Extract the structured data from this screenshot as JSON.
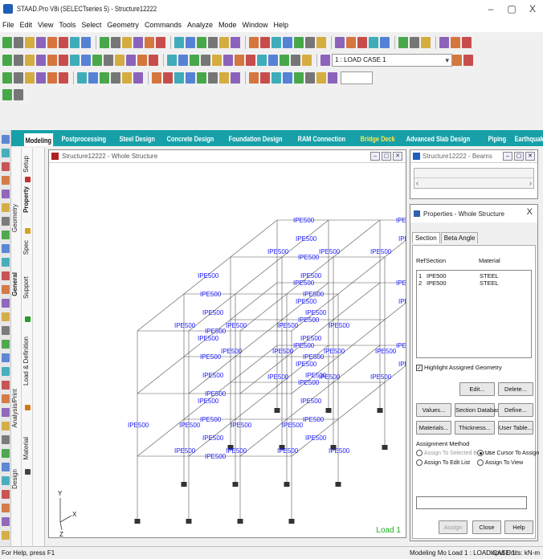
{
  "window": {
    "title": "STAAD.Pro V8i (SELECTseries 5) - Structure12222",
    "minimize": "–",
    "maximize": "▢",
    "close": "X"
  },
  "menu": [
    "File",
    "Edit",
    "View",
    "Tools",
    "Select",
    "Geometry",
    "Commands",
    "Analyze",
    "Mode",
    "Window",
    "Help"
  ],
  "toolbar": {
    "load_case": "1 : LOAD CASE 1"
  },
  "ribbon": {
    "tabs": [
      "Modeling",
      "Postprocessing",
      "Steel Design",
      "Concrete Design",
      "Foundation Design",
      "RAM Connection",
      "Bridge Deck",
      "Advanced Slab Design",
      "Piping",
      "Earthquake"
    ],
    "active": "Modeling"
  },
  "side_tabs": {
    "general": [
      "Setup",
      "Property",
      "Spec",
      "Support",
      "General"
    ],
    "geometry": [
      "Geometry"
    ],
    "analysis": [
      "Load & Definition",
      "Analysis/Print"
    ],
    "design": [
      "Material",
      "Design"
    ]
  },
  "viewport": {
    "title": "Structure12222 - Whole Structure",
    "section_label": "IPE500",
    "load_label": "Load 1",
    "axis_y": "Y",
    "axis_x": "X",
    "axis_z": "Z"
  },
  "beams_panel": {
    "title": "Structure12222 - Beams"
  },
  "properties": {
    "title": "Properties - Whole Structure",
    "tab_section": "Section",
    "tab_beta": "Beta Angle",
    "col_ref": "Ref",
    "col_section": "Section",
    "col_material": "Material",
    "rows": [
      {
        "ref": "1",
        "section": "IPE500",
        "material": "STEEL"
      },
      {
        "ref": "2",
        "section": "IPE500",
        "material": "STEEL"
      }
    ],
    "highlight_label": "Highlight Assigned Geometry",
    "buttons": {
      "edit": "Edit...",
      "delete": "Delete...",
      "values": "Values...",
      "section_db": "Section Database",
      "define": "Define...",
      "materials": "Materials...",
      "thickness": "Thickness...",
      "user_table": "User Table...",
      "assign": "Assign",
      "close": "Close",
      "help": "Help"
    },
    "assignment_method": "Assignment Method",
    "radio": {
      "selected_beams": "Assign To Selected Beams",
      "cursor": "Use Cursor To Assign",
      "edit_list": "Assign To Edit List",
      "view": "Assign To View"
    }
  },
  "status": {
    "left": "For Help, press F1",
    "middle": "Modeling Mo Load 1 : LOAD CASE 1",
    "right": "Input Units:  kN-m"
  },
  "colors": {
    "ribbon": "#17a0a8",
    "label": "#1a1aff",
    "support": "#333333",
    "load_label": "#1ab01a"
  }
}
